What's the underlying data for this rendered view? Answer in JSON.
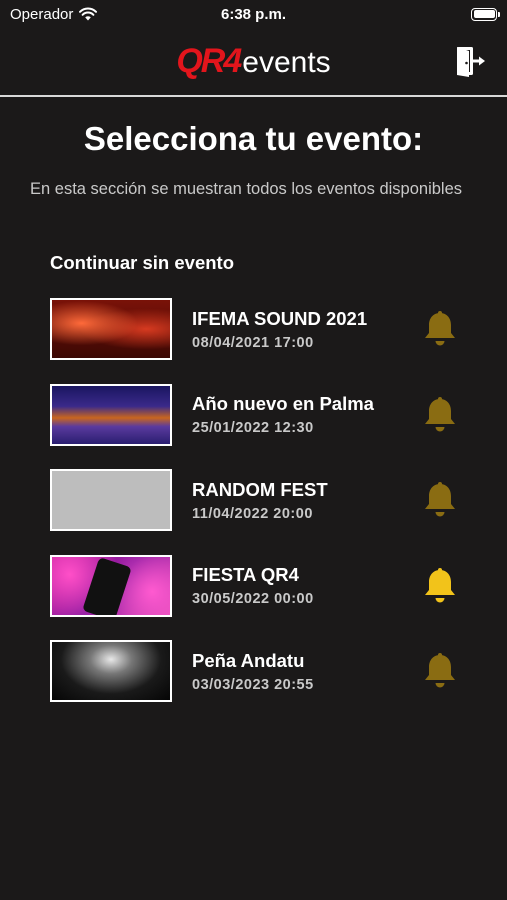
{
  "status_bar": {
    "carrier": "Operador",
    "time": "6:38 p.m."
  },
  "header": {
    "logo_mark": "QR4",
    "logo_text": "events",
    "exit_icon": "exit-door-icon"
  },
  "page": {
    "title": "Selecciona tu evento:",
    "subtitle": "En esta sección se muestran todos los eventos disponibles",
    "continue_label": "Continuar sin evento"
  },
  "events": [
    {
      "name": "IFEMA SOUND 2021",
      "date": "08/04/2021 17:00",
      "bell_active": false
    },
    {
      "name": "Año nuevo en Palma",
      "date": "25/01/2022 12:30",
      "bell_active": false
    },
    {
      "name": "RANDOM FEST",
      "date": "11/04/2022 20:00",
      "bell_active": false
    },
    {
      "name": "FIESTA QR4",
      "date": "30/05/2022 00:00",
      "bell_active": true
    },
    {
      "name": "Peña Andatu",
      "date": "03/03/2023 20:55",
      "bell_active": false
    }
  ],
  "colors": {
    "background": "#1b1919",
    "brand_red": "#e3151c",
    "bell_active": "#f2c31a",
    "bell_inactive": "#8a6c12"
  }
}
